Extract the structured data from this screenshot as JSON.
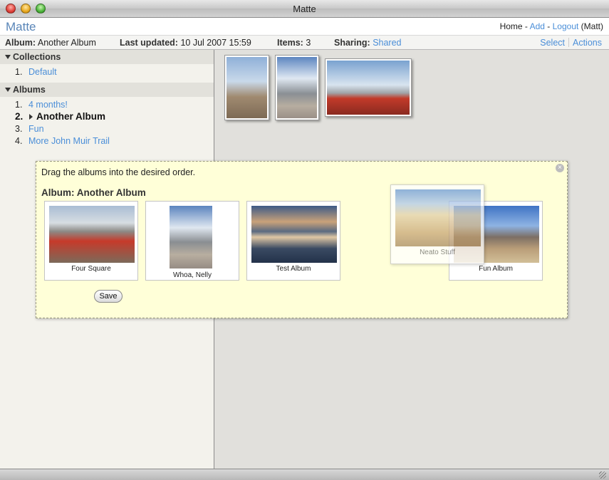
{
  "window": {
    "title": "Matte"
  },
  "header": {
    "brand": "Matte",
    "nav": {
      "home": "Home",
      "sep1": " - ",
      "add": "Add",
      "sep2": " - ",
      "logout": "Logout",
      "user": " (Matt)"
    }
  },
  "infobar": {
    "album_label": "Album:",
    "album_value": "Another Album",
    "updated_label": "Last updated:",
    "updated_value": "10 Jul 2007 15:59",
    "items_label": "Items:",
    "items_value": "3",
    "sharing_label": "Sharing:",
    "sharing_value": "Shared",
    "select": "Select",
    "actions": "Actions"
  },
  "sidebar": {
    "collections": {
      "title": "Collections",
      "items": [
        {
          "num": "1.",
          "label": "Default"
        }
      ]
    },
    "albums": {
      "title": "Albums",
      "items": [
        {
          "num": "1.",
          "label": "4 months!"
        },
        {
          "num": "2.",
          "label": "Another Album"
        },
        {
          "num": "3.",
          "label": "Fun"
        },
        {
          "num": "4.",
          "label": "More John Muir Trail"
        }
      ]
    }
  },
  "dialog": {
    "instruction": "Drag the albums into the desired order.",
    "album_title": "Album: Another Album",
    "albums": [
      {
        "caption": "Four Square"
      },
      {
        "caption": "Whoa, Nelly"
      },
      {
        "caption": "Test Album"
      },
      {
        "caption": "Neato Stuff"
      },
      {
        "caption": "Fun Album"
      }
    ],
    "save": "Save"
  }
}
